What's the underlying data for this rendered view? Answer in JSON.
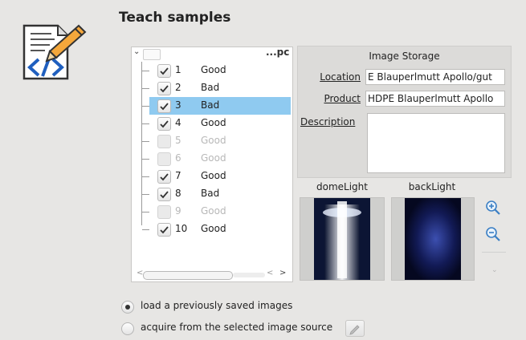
{
  "dialog": {
    "title": "Teach samples"
  },
  "samples": {
    "header_label": "...pc",
    "rows": [
      {
        "num": "1",
        "label": "Good",
        "checked": true,
        "enabled": true
      },
      {
        "num": "2",
        "label": "Bad",
        "checked": true,
        "enabled": true
      },
      {
        "num": "3",
        "label": "Bad",
        "checked": true,
        "enabled": true,
        "selected": true
      },
      {
        "num": "4",
        "label": "Good",
        "checked": true,
        "enabled": true
      },
      {
        "num": "5",
        "label": "Good",
        "checked": false,
        "enabled": false
      },
      {
        "num": "6",
        "label": "Good",
        "checked": false,
        "enabled": false
      },
      {
        "num": "7",
        "label": "Good",
        "checked": true,
        "enabled": true
      },
      {
        "num": "8",
        "label": "Bad",
        "checked": true,
        "enabled": true
      },
      {
        "num": "9",
        "label": "Good",
        "checked": false,
        "enabled": false
      },
      {
        "num": "10",
        "label": "Good",
        "checked": true,
        "enabled": true
      }
    ]
  },
  "storage": {
    "title": "Image Storage",
    "location_label": "Location",
    "location_value": "E Blauperlmutt Apollo/gut",
    "product_label": "Product",
    "product_value": "HDPE Blauperlmutt Apollo",
    "description_label": "Description",
    "description_value": ""
  },
  "lights": {
    "dome_label": "domeLight",
    "back_label": "backLight"
  },
  "source": {
    "option_load": "load a previously saved images",
    "option_load_selected": true,
    "option_acquire": "acquire from the selected image source",
    "option_acquire_selected": false
  },
  "colors": {
    "selection": "#8fcaf0",
    "icon_blue": "#1f5fbf",
    "icon_orange": "#f4a73b"
  }
}
